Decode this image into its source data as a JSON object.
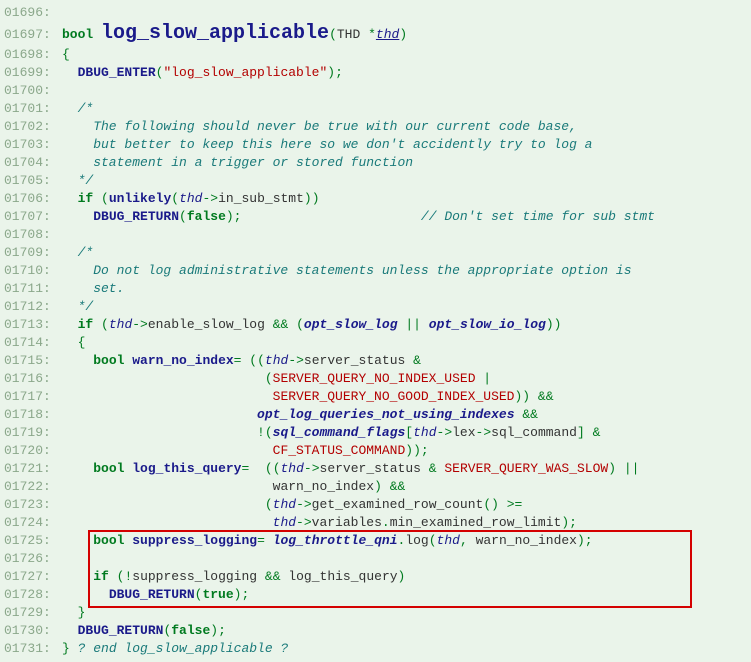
{
  "lines": {
    "L1696": "01696:",
    "L1697": "01697:",
    "L1698": "01698:",
    "L1699": "01699:",
    "L1700": "01700:",
    "L1701": "01701:",
    "L1702": "01702:",
    "L1703": "01703:",
    "L1704": "01704:",
    "L1705": "01705:",
    "L1706": "01706:",
    "L1707": "01707:",
    "L1708": "01708:",
    "L1709": "01709:",
    "L1710": "01710:",
    "L1711": "01711:",
    "L1712": "01712:",
    "L1713": "01713:",
    "L1714": "01714:",
    "L1715": "01715:",
    "L1716": "01716:",
    "L1717": "01717:",
    "L1718": "01718:",
    "L1719": "01719:",
    "L1720": "01720:",
    "L1721": "01721:",
    "L1722": "01722:",
    "L1723": "01723:",
    "L1724": "01724:",
    "L1725": "01725:",
    "L1726": "01726:",
    "L1727": "01727:",
    "L1728": "01728:",
    "L1729": "01729:",
    "L1730": "01730:",
    "L1731": "01731:"
  },
  "tok": {
    "bool": "bool",
    "bool_sp": "bool ",
    "fn": "log_slow_applicable",
    "dbug_enter": "DBUG_ENTER",
    "dbug_return": "DBUG_RETURN",
    "thd_ty": "THD ",
    "thd": "thd",
    "star": "*",
    "quote_str": "\"log_slow_applicable\"",
    "lbrace": "{",
    "rbrace": "}",
    "lp": "(",
    "rp": ")",
    "rpp": "))",
    "rppsc": "));",
    "rpsc": ");",
    "sc": ";",
    "arrow": "->",
    "dot": ".",
    "comma": ", ",
    "in_sub_stmt": "in_sub_stmt",
    "enable_slow_log": "enable_slow_log ",
    "server_status": "server_status ",
    "server_status2": "server_status",
    "lex": "lex",
    "sql_command": "sql_command",
    "get_examined_row_count": "get_examined_row_count",
    "variables": "variables",
    "min_examined_row_limit": "min_examined_row_limit",
    "if": "if",
    "false": "false",
    "true": "true",
    "unlikely": "unlikely",
    "warn_no_index": "warn_no_index",
    "warn_no_index_sp": " warn_no_index",
    "log_this_query": "log_this_query",
    "suppress_logging": "suppress_logging",
    "log_throttle_qni": "log_throttle_qni",
    "log_call": "log",
    "opt_slow_log": "opt_slow_log",
    "opt_slow_io_log": "opt_slow_io_log",
    "opt_log_queries_not_using_indexes": "opt_log_queries_not_using_indexes",
    "sql_command_flags": "sql_command_flags",
    "amp": "&",
    "ampamp": "&&",
    "oror": "||",
    "bang": "!",
    "gte": ">=",
    "qeq": "=  ",
    "eq": "= ",
    "lbr": "[",
    "rbr": "] ",
    "pipe": " |",
    "SQNI": "SERVER_QUERY_NO_INDEX_USED",
    "SQNGI": "SERVER_QUERY_NO_GOOD_INDEX_USED",
    "SQWS": "SERVER_QUERY_WAS_SLOW",
    "CFSC": "CF_STATUS_COMMAND",
    "cmt_open": "/*",
    "cmt_close": "*/",
    "cmt1": "    The following should never be true with our current code base,",
    "cmt2": "    but better to keep this here so we don't accidently try to log a",
    "cmt3": "    statement in a trigger or stored function",
    "cmt4": "    Do not log administrative statements unless the appropriate option is",
    "cmt5": "    set.",
    "cmt_side": "// Don't set time for sub stmt",
    "cmt_end": "? end log_slow_applicable ?",
    "sp2": "  ",
    "sp4": "    ",
    "sp6": "      ",
    "sp1": " ",
    "sp24": "                        ",
    "sp25": "                         ",
    "sp26": "                          ",
    "sp27": "                           ",
    "sp28": "                            ",
    "sp_side": "                       "
  }
}
